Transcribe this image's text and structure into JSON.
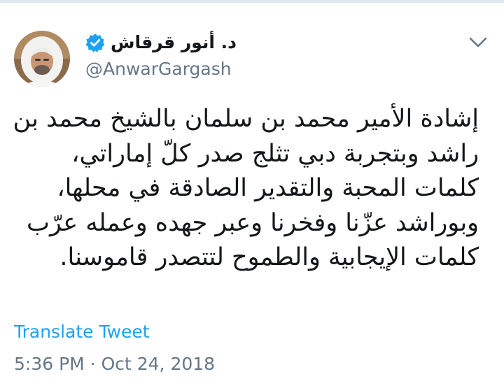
{
  "author": {
    "display_name": "د. أنور قرقاش",
    "handle": "@AnwarGargash",
    "verified_icon": "verified-badge-icon",
    "avatar": "profile-photo"
  },
  "tweet": {
    "lines": [
      "إشادة الأمير محمد بن سلمان بالشيخ محمد بن",
      "راشد وبتجربة دبي تثلج صدر كلّ إماراتي،",
      "كلمات المحبة والتقدير الصادقة في محلها،",
      "وبوراشد عزّنا وفخرنا وعبر جهده وعمله عرّب",
      "كلمات الإيجابية والطموح لتتصدر قاموسنا."
    ]
  },
  "actions": {
    "translate_label": "Translate Tweet",
    "more_icon": "chevron-down-icon"
  },
  "meta": {
    "timestamp": "5:36 PM · Oct 24, 2018"
  },
  "colors": {
    "text": "#14171a",
    "secondary": "#657786",
    "link": "#1da1f2",
    "verified": "#1da1f2"
  }
}
